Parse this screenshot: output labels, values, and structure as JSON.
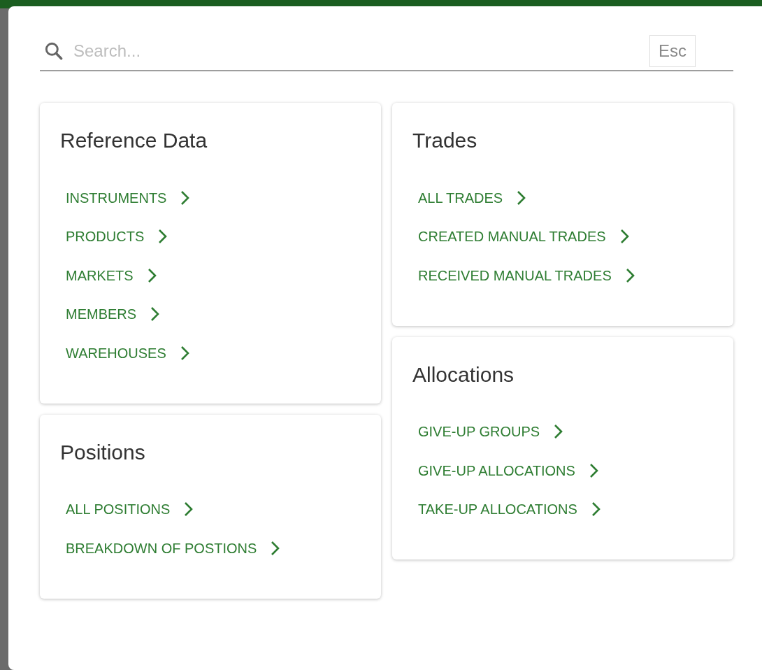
{
  "search": {
    "placeholder": "Search...",
    "shortcut": "Esc"
  },
  "columns": [
    [
      {
        "title": "Reference Data",
        "links": [
          "INSTRUMENTS",
          "PRODUCTS",
          "MARKETS",
          "MEMBERS",
          "WAREHOUSES"
        ]
      },
      {
        "title": "Positions",
        "links": [
          "ALL POSITIONS",
          "BREAKDOWN OF POSTIONS"
        ]
      }
    ],
    [
      {
        "title": "Trades",
        "links": [
          "ALL TRADES",
          "CREATED MANUAL TRADES",
          "RECEIVED MANUAL TRADES"
        ]
      },
      {
        "title": "Allocations",
        "links": [
          "GIVE-UP GROUPS",
          "GIVE-UP ALLOCATIONS",
          "TAKE-UP ALLOCATIONS"
        ]
      }
    ]
  ]
}
